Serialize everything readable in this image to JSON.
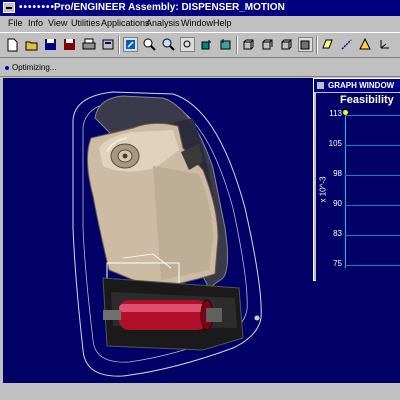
{
  "window": {
    "title_dots": "••••••••",
    "title": "Pro/ENGINEER Assembly: DISPENSER_MOTION"
  },
  "menu": [
    "File",
    "Info",
    "View",
    "Utilities",
    "Applications",
    "Analysis",
    "Window",
    "Help"
  ],
  "toolbar": {
    "buttons": [
      "new-icon",
      "open-icon",
      "save-icon",
      "save-as-icon",
      "print-icon",
      "repaint-icon",
      "zoom-in-icon",
      "zoom-out-icon",
      "refit-icon",
      "orient-icon",
      "saved-views-icon",
      "wireframe-icon",
      "hidden-line-icon",
      "no-hidden-icon",
      "shading-icon",
      "datum-planes-icon",
      "datum-axes-icon",
      "datum-points-icon",
      "coordinate-systems-icon"
    ]
  },
  "status": {
    "message": "Optimizing..."
  },
  "graph_window": {
    "title": "GRAPH WINDOW",
    "heading": "Feasibility",
    "y_unit": "x 10^-3",
    "y_ticks": [
      "113",
      "105",
      "98",
      "90",
      "83",
      "75"
    ]
  }
}
